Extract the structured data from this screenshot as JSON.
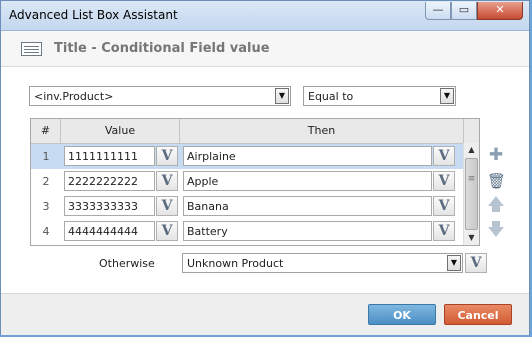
{
  "window": {
    "title": "Advanced List Box Assistant",
    "minimize": "—",
    "maximize": "▭",
    "close": "✕"
  },
  "header": {
    "title": "Title - Conditional Field value",
    "icon": "list-form-icon"
  },
  "filters": {
    "field_value": "<inv.Product>",
    "operator_value": "Equal to"
  },
  "grid": {
    "columns": [
      "#",
      "Value",
      "Then"
    ],
    "rows": [
      {
        "num": "1",
        "value": "1111111111",
        "then": "Airplaine"
      },
      {
        "num": "2",
        "value": "2222222222",
        "then": "Apple"
      },
      {
        "num": "3",
        "value": "3333333333",
        "then": "Banana"
      },
      {
        "num": "4",
        "value": "4444444444",
        "then": "Battery"
      }
    ],
    "v_button": "V",
    "selected_row": 1
  },
  "side_actions": {
    "add": "✚",
    "delete": "🗑",
    "up": "🡅",
    "down": "🡇"
  },
  "otherwise": {
    "label": "Otherwise",
    "value": "Unknown Product"
  },
  "footer": {
    "ok_label": "OK",
    "cancel_label": "Cancel"
  },
  "colors": {
    "ok": "#4b8fc4",
    "cancel": "#d05b32",
    "selected_row": "#c7dcf3"
  }
}
